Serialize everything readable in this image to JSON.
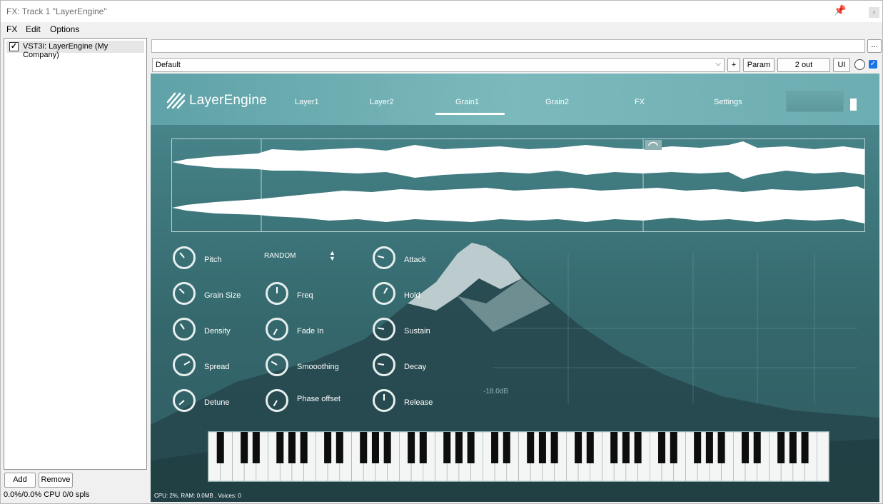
{
  "window": {
    "title": "FX: Track 1 \"LayerEngine\""
  },
  "menu": [
    "FX",
    "Edit",
    "Options"
  ],
  "fx_list": {
    "items": [
      {
        "label": "VST3i: LayerEngine (My Company)",
        "checked": true
      }
    ]
  },
  "buttons": {
    "add": "Add",
    "remove": "Remove",
    "browse": "...",
    "plus": "+",
    "param": "Param",
    "outs": "2 out",
    "ui": "UI"
  },
  "status": "0.0%/0.0% CPU 0/0 spls",
  "preset": {
    "value": "Default"
  },
  "plugin": {
    "brand": "LayerEngine",
    "tabs": [
      "Layer1",
      "Layer2",
      "Grain1",
      "Grain2",
      "FX",
      "Settings"
    ],
    "active_tab": "Grain1",
    "random_label": "RANDOM",
    "db_label": "-18.0dB",
    "controls": {
      "col1": [
        "Pitch",
        "Grain Size",
        "Density",
        "Spread",
        "Detune"
      ],
      "col2": [
        "Freq",
        "Fade In",
        "Smooothing",
        "Phase offset"
      ],
      "col3": [
        "Attack",
        "Hold",
        "Sustain",
        "Decay",
        "Release"
      ]
    },
    "cpu_readout": "CPU: 2%, RAM: 0.0MB , Voices: 0"
  },
  "colors": {
    "accent": "#1a73e8",
    "header": "#6cadb1",
    "panel": "#34676c"
  }
}
